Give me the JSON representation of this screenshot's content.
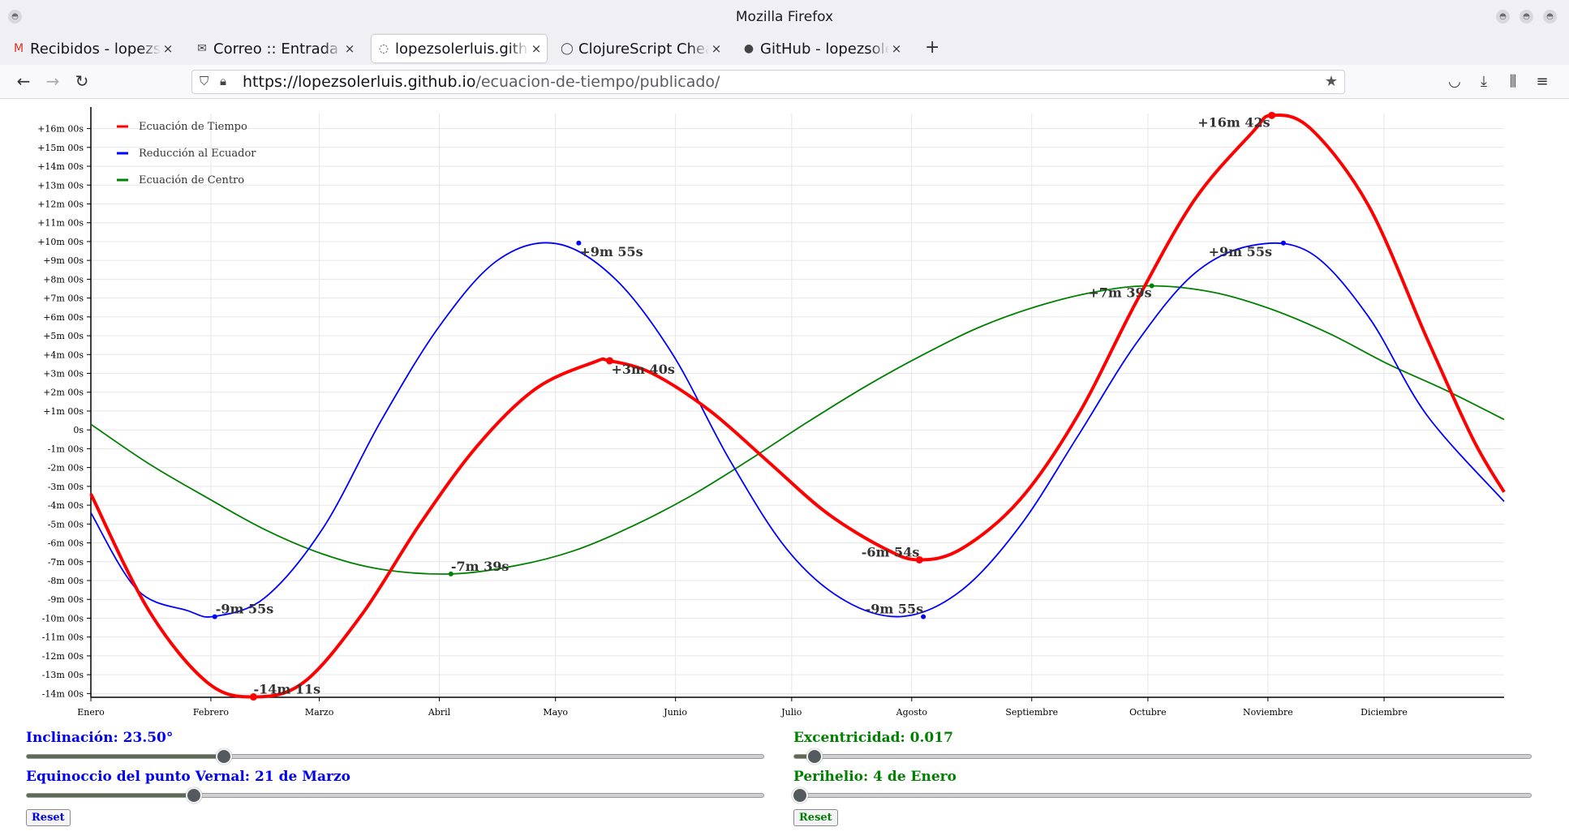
{
  "window": {
    "title": "Mozilla Firefox"
  },
  "tabs": [
    {
      "label": "Recibidos - lopezsol",
      "icon": "M",
      "icon_name": "gmail-icon",
      "active": false
    },
    {
      "label": "Correo :: Entrada",
      "icon": "✉",
      "icon_name": "mail-icon",
      "active": false
    },
    {
      "label": "lopezsolerluis.github",
      "icon": "◌",
      "icon_name": "site-icon",
      "active": true
    },
    {
      "label": "ClojureScript Cheat",
      "icon": "◯",
      "icon_name": "clojure-icon",
      "active": false
    },
    {
      "label": "GitHub - lopezsolerl",
      "icon": "●",
      "icon_name": "github-icon",
      "active": false
    }
  ],
  "urlbar": {
    "domain": "https://lopezsolerluis.github.io",
    "path": "/ecuacion-de-tiempo/publicado/"
  },
  "chart_data": {
    "type": "line",
    "x_categories": [
      "Enero",
      "Febrero",
      "Marzo",
      "Abril",
      "Mayo",
      "Junio",
      "Julio",
      "Agosto",
      "Septiembre",
      "Octubre",
      "Noviembre",
      "Diciembre"
    ],
    "x_range_days": [
      0,
      365
    ],
    "y_ticks": [
      "+16m 00s",
      "+15m 00s",
      "+14m 00s",
      "+13m 00s",
      "+12m 00s",
      "+11m 00s",
      "+10m 00s",
      "+9m 00s",
      "+8m 00s",
      "+7m 00s",
      "+6m 00s",
      "+5m 00s",
      "+4m 00s",
      "+3m 00s",
      "+2m 00s",
      "+1m 00s",
      "0s",
      "-1m 00s",
      "-2m 00s",
      "-3m 00s",
      "-4m 00s",
      "-5m 00s",
      "-6m 00s",
      "-7m 00s",
      "-8m 00s",
      "-9m 00s",
      "-10m 00s",
      "-11m 00s",
      "-12m 00s",
      "-13m 00s",
      "-14m 00s"
    ],
    "y_range_minutes": [
      -14.2,
      16.8
    ],
    "grid": true,
    "legend_position": "top-left",
    "series": [
      {
        "name": "Ecuación de Tiempo",
        "color": "#ff0000",
        "stroke": 4,
        "points": [
          [
            0,
            -3.4
          ],
          [
            15,
            -9.6
          ],
          [
            30,
            -13.4
          ],
          [
            42,
            -14.18
          ],
          [
            55,
            -13.4
          ],
          [
            70,
            -9.8
          ],
          [
            85,
            -5.0
          ],
          [
            100,
            -0.8
          ],
          [
            115,
            2.2
          ],
          [
            130,
            3.6
          ],
          [
            134,
            3.67
          ],
          [
            145,
            3.0
          ],
          [
            160,
            1.0
          ],
          [
            175,
            -1.7
          ],
          [
            190,
            -4.4
          ],
          [
            205,
            -6.3
          ],
          [
            214,
            -6.9
          ],
          [
            225,
            -6.3
          ],
          [
            240,
            -3.7
          ],
          [
            255,
            0.8
          ],
          [
            270,
            6.8
          ],
          [
            285,
            12.2
          ],
          [
            300,
            15.8
          ],
          [
            305,
            16.7
          ],
          [
            315,
            16.0
          ],
          [
            330,
            11.9
          ],
          [
            345,
            4.9
          ],
          [
            357,
            -0.5
          ],
          [
            365,
            -3.3
          ]
        ]
      },
      {
        "name": "Reducción al Ecuador",
        "color": "#0000ff",
        "stroke": 1.8,
        "points": [
          [
            0,
            -4.4
          ],
          [
            12,
            -8.5
          ],
          [
            25,
            -9.6
          ],
          [
            32,
            -9.9
          ],
          [
            45,
            -8.9
          ],
          [
            60,
            -5.2
          ],
          [
            75,
            0.5
          ],
          [
            90,
            5.5
          ],
          [
            105,
            9.0
          ],
          [
            120,
            9.9
          ],
          [
            135,
            8.1
          ],
          [
            150,
            4.1
          ],
          [
            165,
            -1.6
          ],
          [
            180,
            -6.4
          ],
          [
            195,
            -9.1
          ],
          [
            210,
            -9.9
          ],
          [
            225,
            -8.5
          ],
          [
            240,
            -5.1
          ],
          [
            255,
            -0.3
          ],
          [
            270,
            4.6
          ],
          [
            285,
            8.3
          ],
          [
            300,
            9.8
          ],
          [
            315,
            9.4
          ],
          [
            330,
            6.0
          ],
          [
            345,
            0.8
          ],
          [
            365,
            -3.8
          ]
        ]
      },
      {
        "name": "Ecuación de Centro",
        "color": "#008000",
        "stroke": 1.8,
        "points": [
          [
            0,
            0.3
          ],
          [
            15,
            -1.8
          ],
          [
            30,
            -3.6
          ],
          [
            45,
            -5.3
          ],
          [
            60,
            -6.6
          ],
          [
            75,
            -7.4
          ],
          [
            93,
            -7.65
          ],
          [
            110,
            -7.2
          ],
          [
            125,
            -6.4
          ],
          [
            140,
            -5.1
          ],
          [
            155,
            -3.5
          ],
          [
            170,
            -1.6
          ],
          [
            185,
            0.4
          ],
          [
            200,
            2.3
          ],
          [
            215,
            4.0
          ],
          [
            230,
            5.5
          ],
          [
            245,
            6.6
          ],
          [
            260,
            7.35
          ],
          [
            274,
            7.65
          ],
          [
            290,
            7.3
          ],
          [
            305,
            6.4
          ],
          [
            320,
            5.1
          ],
          [
            335,
            3.5
          ],
          [
            350,
            2.1
          ],
          [
            365,
            0.55
          ]
        ]
      }
    ],
    "annotations": [
      {
        "text": "+16m 42s",
        "x": 305,
        "y": 16.7,
        "color": "#ff0000",
        "dot": true,
        "anchor": "end",
        "dx": -2,
        "dy": 14
      },
      {
        "text": "+3m 40s",
        "x": 134,
        "y": 3.67,
        "color": "#ff0000",
        "dot": true,
        "anchor": "start",
        "dx": 2,
        "dy": 16
      },
      {
        "text": "-6m 54s",
        "x": 214,
        "y": -6.9,
        "color": "#ff0000",
        "dot": true,
        "anchor": "end",
        "dx": 0,
        "dy": -4
      },
      {
        "text": "-14m 11s",
        "x": 42,
        "y": -14.18,
        "color": "#ff0000",
        "dot": true,
        "anchor": "start",
        "dx": 0,
        "dy": -4
      },
      {
        "text": "+9m 55s",
        "x": 126,
        "y": 9.92,
        "color": "#0000ff",
        "dot": true,
        "anchor": "start",
        "dx": 1,
        "dy": 16
      },
      {
        "text": "+9m 55s",
        "x": 308,
        "y": 9.92,
        "color": "#0000ff",
        "dot": true,
        "anchor": "end",
        "dx": -14,
        "dy": 16
      },
      {
        "text": "-9m 55s",
        "x": 32,
        "y": -9.92,
        "color": "#0000ff",
        "dot": true,
        "anchor": "start",
        "dx": 1,
        "dy": -4
      },
      {
        "text": "-9m 55s",
        "x": 215,
        "y": -9.92,
        "color": "#0000ff",
        "dot": true,
        "anchor": "end",
        "dx": 0,
        "dy": -4
      },
      {
        "text": "-7m 39s",
        "x": 93,
        "y": -7.65,
        "color": "#008000",
        "dot": true,
        "anchor": "start",
        "dx": 0,
        "dy": -4
      },
      {
        "text": "+7m 39s",
        "x": 274,
        "y": 7.65,
        "color": "#008000",
        "dot": true,
        "anchor": "end",
        "dx": 0,
        "dy": 14
      }
    ]
  },
  "controls": {
    "inclinacion": {
      "label": "Inclinación: 23.50°",
      "color": "#0000ee",
      "value_fraction": 0.267
    },
    "equinoccio": {
      "label": "Equinoccio del punto Vernal: 21 de Marzo",
      "color": "#0000ee",
      "value_fraction": 0.226
    },
    "excentricidad": {
      "label": "Excentricidad: 0.017",
      "color": "#008000",
      "value_fraction": 0.027
    },
    "perihelio": {
      "label": "Perihelio: 4 de Enero",
      "color": "#008000",
      "value_fraction": 0.008
    },
    "reset_label": "Reset"
  }
}
